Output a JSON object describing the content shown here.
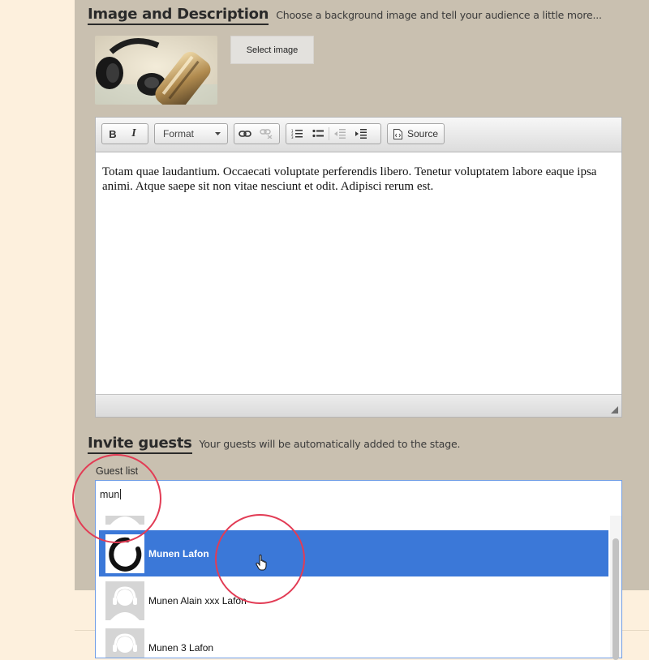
{
  "image_section": {
    "title": "Image and Description",
    "subtitle": "Choose a background image and tell your audience a little more...",
    "select_button": "Select image"
  },
  "editor": {
    "toolbar": {
      "bold": "B",
      "italic": "I",
      "format_label": "Format",
      "source_label": "Source"
    },
    "content": "Totam quae laudantium. Occaecati voluptate perferendis libero. Tenetur voluptatem labore eaque ipsa animi. Atque saepe sit non vitae nesciunt et odit. Adipisci rerum est."
  },
  "invite_section": {
    "title": "Invite guests",
    "subtitle": "Your guests will be automatically added to the stage.",
    "guest_list_label": "Guest list",
    "search_value": "mun",
    "options": [
      {
        "name": "",
        "selected": false
      },
      {
        "name": "Munen Lafon",
        "selected": true
      },
      {
        "name": "Munen Alain xxx Lafon",
        "selected": false
      },
      {
        "name": "Munen 3 Lafon",
        "selected": false
      }
    ]
  },
  "colors": {
    "page_background": "#fdf0dd",
    "panel_background": "#c9c0b0",
    "highlight": "#3b78d8",
    "annotation_ring": "#e23c55"
  },
  "icons": [
    "link-icon",
    "unlink-icon",
    "numbered-list-icon",
    "bulleted-list-icon",
    "decrease-indent-icon",
    "increase-indent-icon",
    "source-icon",
    "hand-cursor-icon",
    "person-placeholder-icon",
    "enso-avatar-icon"
  ]
}
